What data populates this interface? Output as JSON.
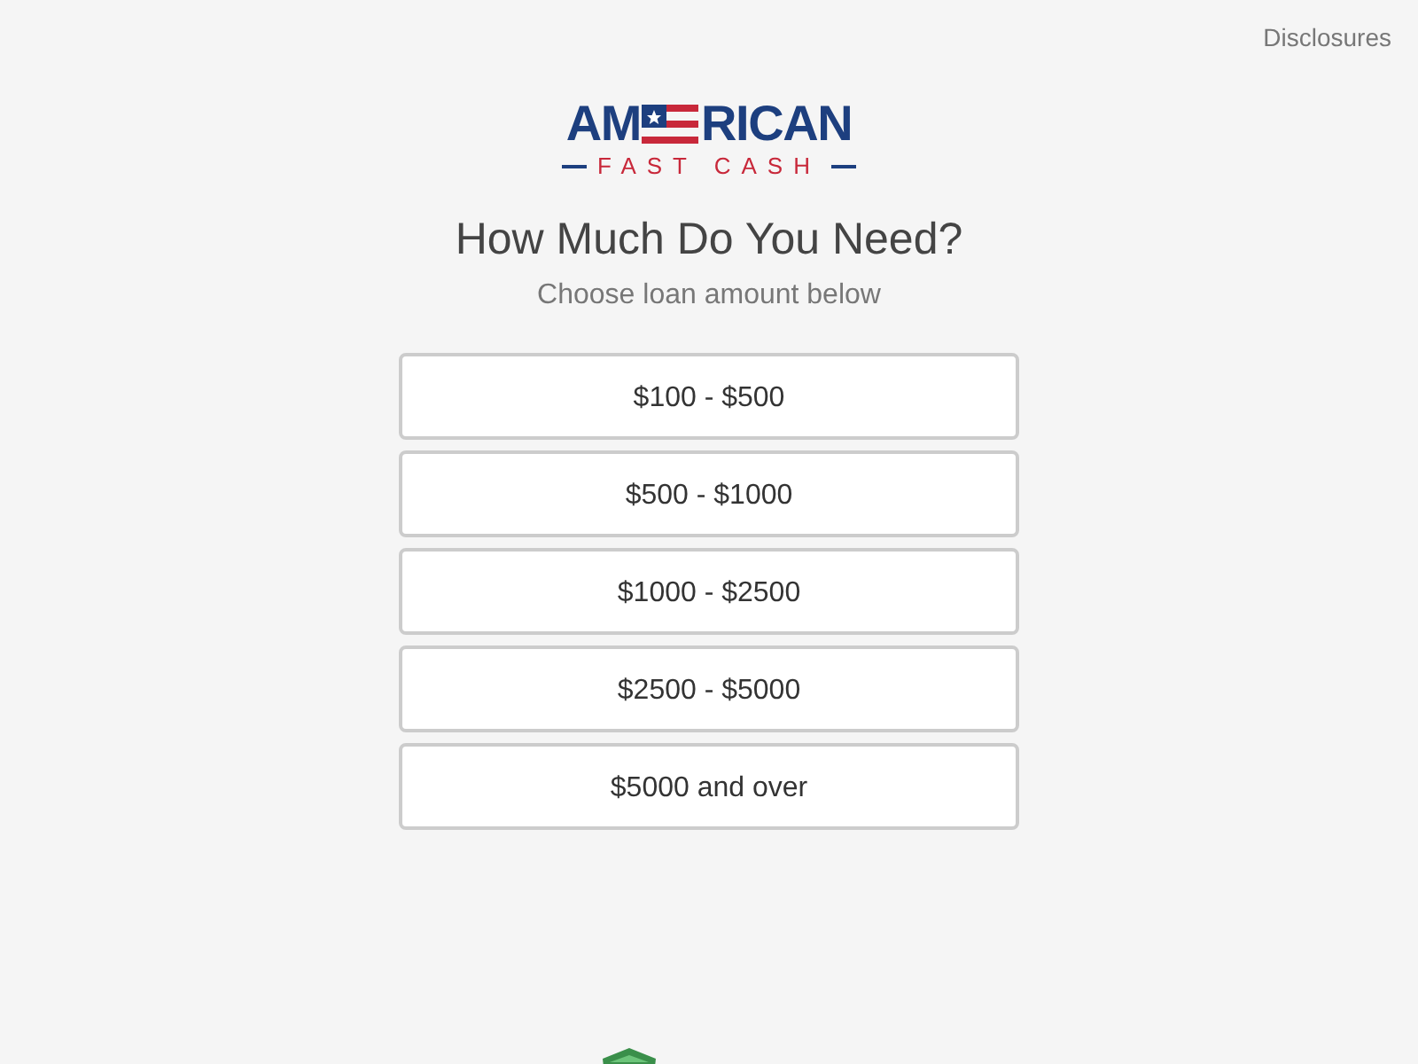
{
  "header_link": "Disclosures",
  "logo": {
    "left": "AM",
    "right": "RICAN",
    "tagline": "FAST CASH"
  },
  "title": "How Much Do You Need?",
  "subtitle": "Choose loan amount below",
  "options": [
    "$100 - $500",
    "$500 - $1000",
    "$1000 - $2500",
    "$2500 - $5000",
    "$5000 and over"
  ]
}
